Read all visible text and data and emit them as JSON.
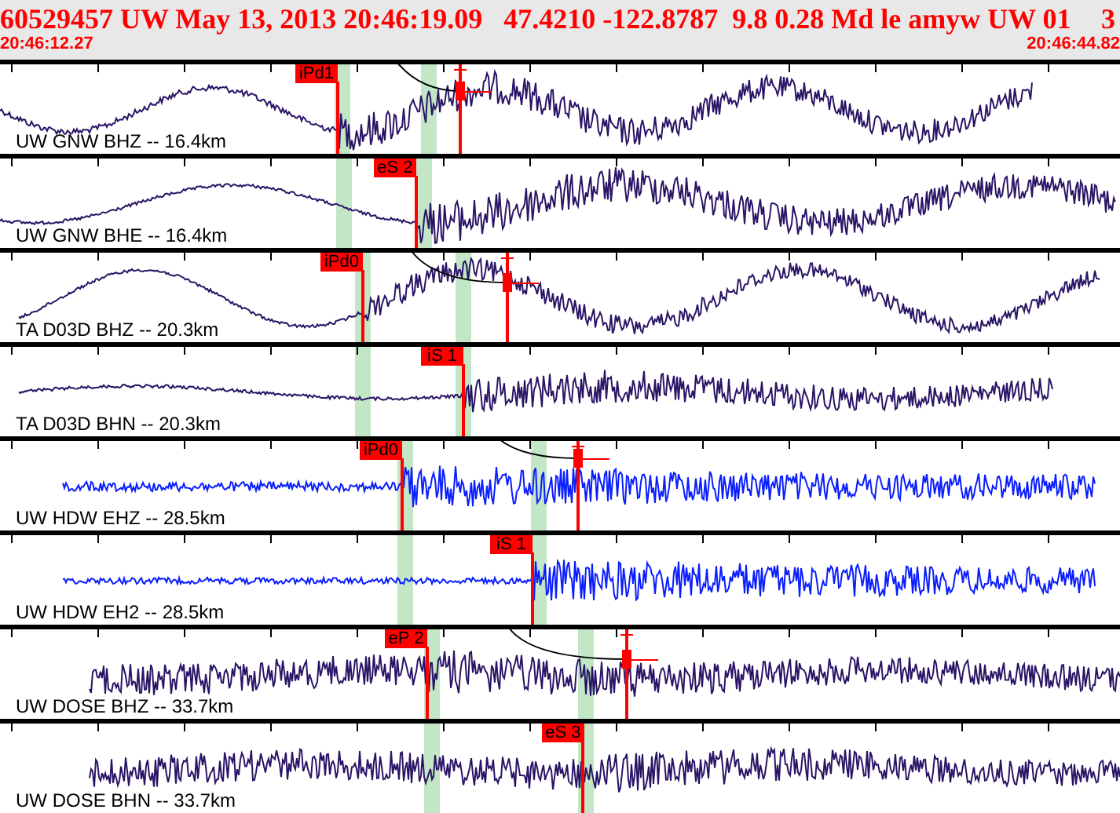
{
  "header": {
    "title": "60529457 UW May 13, 2013 20:46:19.09   47.4210 -122.8787  9.8 0.28 Md le amyw UW 01",
    "title_end": "3",
    "start_time": "20:46:12.27",
    "end_time": "20:46:44.82"
  },
  "traces": [
    {
      "label": "UW GNW BHZ -- 16.4km",
      "color": "#2a1466",
      "pick": "iPd1"
    },
    {
      "label": "UW GNW BHE -- 16.4km",
      "color": "#2a1466",
      "pick": "eS 2"
    },
    {
      "label": "TA D03D BHZ -- 20.3km",
      "color": "#2a1466",
      "pick": "iPd0"
    },
    {
      "label": "TA D03D BHN -- 20.3km",
      "color": "#2a1466",
      "pick": "iS 1"
    },
    {
      "label": "UW HDW EHZ -- 28.5km",
      "color": "#0a1eff",
      "pick": "iPd0"
    },
    {
      "label": "UW HDW EH2 -- 28.5km",
      "color": "#0a1eff",
      "pick": "iS 1"
    },
    {
      "label": "UW DOSE BHZ -- 33.7km",
      "color": "#2a1466",
      "pick": "eP 2"
    },
    {
      "label": "UW DOSE BHN -- 33.7km",
      "color": "#2a1466",
      "pick": "eS 3"
    }
  ]
}
